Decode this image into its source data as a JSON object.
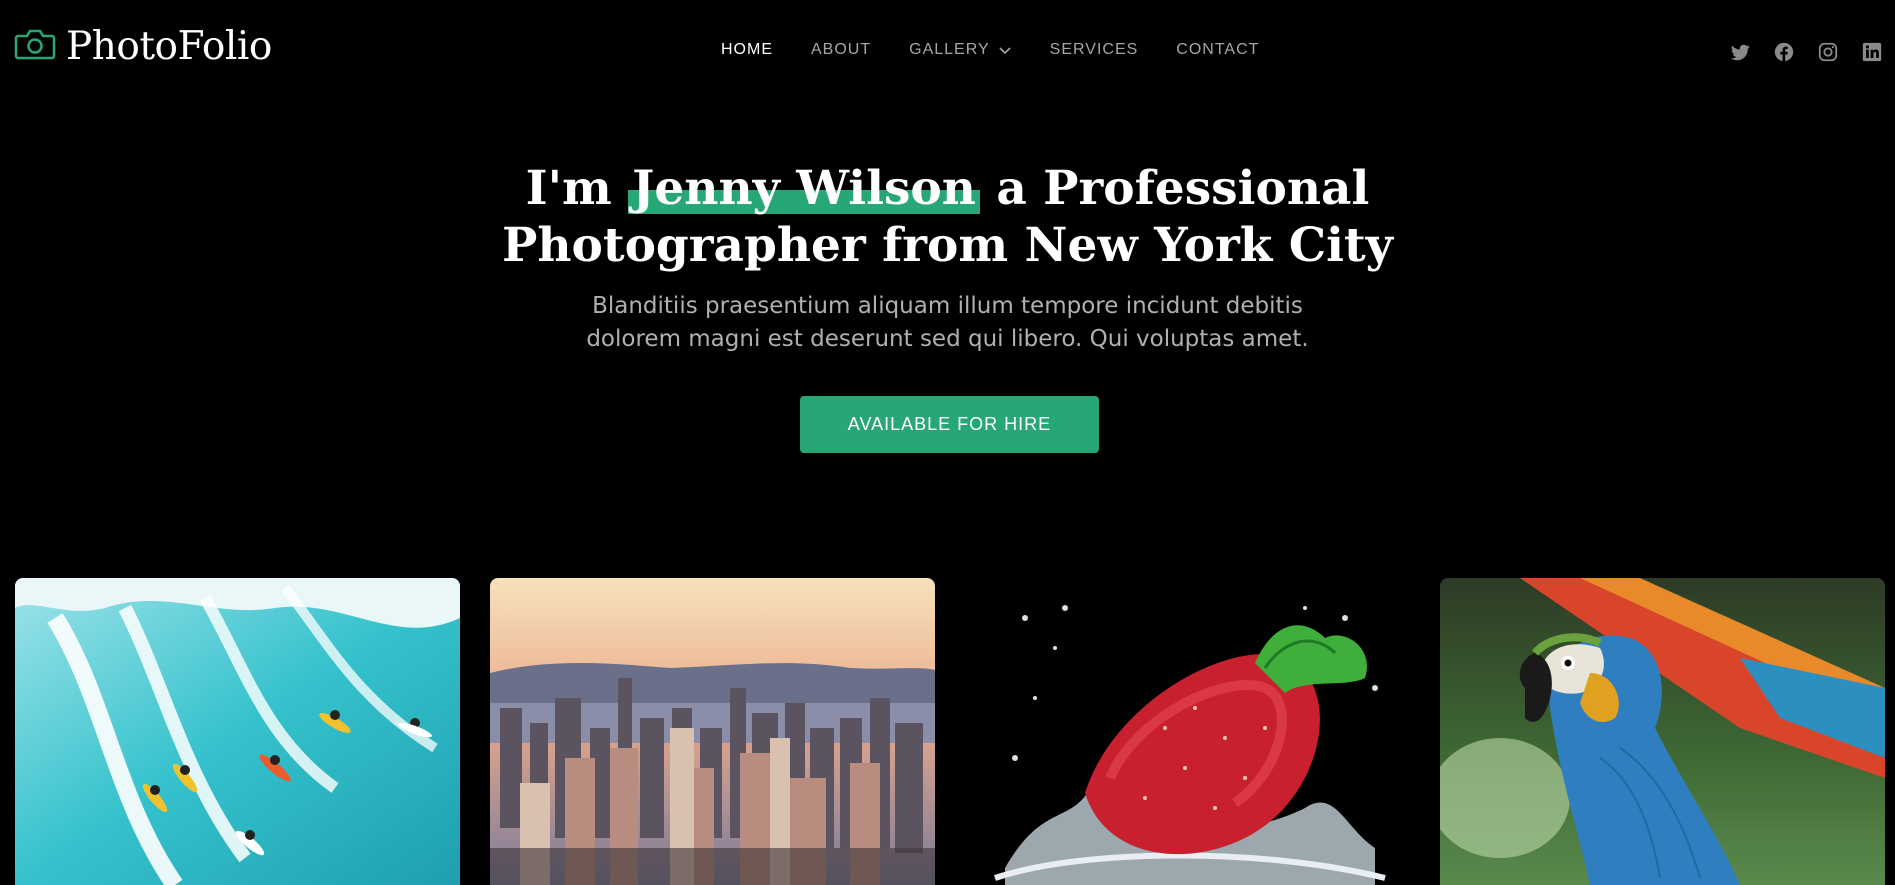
{
  "brand": {
    "name": "PhotoFolio",
    "icon": "camera-icon",
    "accent": "#27a776"
  },
  "nav": {
    "items": [
      {
        "label": "HOME",
        "active": true
      },
      {
        "label": "ABOUT"
      },
      {
        "label": "GALLERY",
        "has_dropdown": true
      },
      {
        "label": "SERVICES"
      },
      {
        "label": "CONTACT"
      }
    ]
  },
  "socials": [
    "twitter-icon",
    "facebook-icon",
    "instagram-icon",
    "linkedin-icon"
  ],
  "hero": {
    "title_prefix": "I'm ",
    "title_name": "Jenny Wilson",
    "title_suffix_line1": " a Professional",
    "title_line2": "Photographer from New York City",
    "subtitle": "Blanditiis praesentium aliquam illum tempore incidunt debitis dolorem magni est deserunt sed qui libero. Qui voluptas amet.",
    "cta_label": "AVAILABLE FOR HIRE"
  },
  "gallery": [
    {
      "subject": "surfers"
    },
    {
      "subject": "city-skyline"
    },
    {
      "subject": "strawberry-splash"
    },
    {
      "subject": "macaw-parrot"
    }
  ]
}
